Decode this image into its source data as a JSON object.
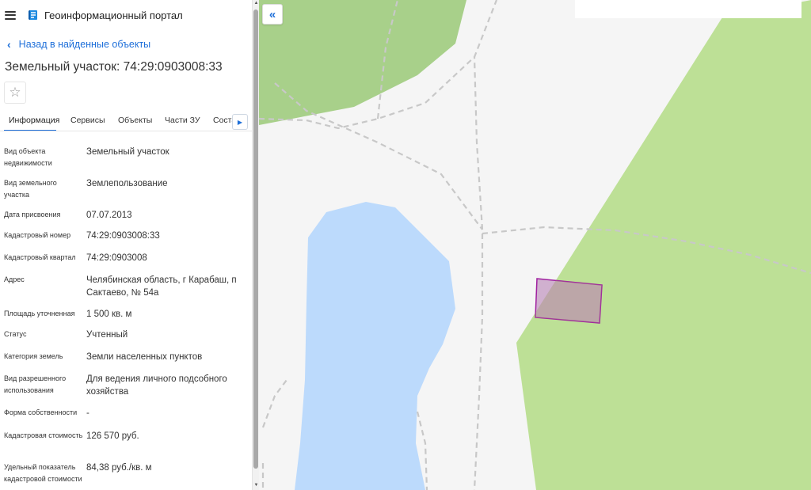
{
  "header": {
    "menu_icon": "hamburger-icon",
    "logo_icon": "portal-logo-icon",
    "title": "Геоинформационный портал"
  },
  "back_link": {
    "label": "Назад в найденные объекты",
    "icon": "chevron-left-icon"
  },
  "object_title": "Земельный участок: 74:29:0903008:33",
  "favorite_icon": "star-icon",
  "tabs": [
    {
      "label": "Информация",
      "active": true
    },
    {
      "label": "Сервисы"
    },
    {
      "label": "Объекты"
    },
    {
      "label": "Части ЗУ"
    },
    {
      "label": "Соста"
    }
  ],
  "tabs_next_icon": "arrow-right-icon",
  "properties": [
    {
      "label": "Вид объекта недвижимости",
      "value": "Земельный участок"
    },
    {
      "label": "Вид земельного участка",
      "value": "Землепользование"
    },
    {
      "label": "Дата присвоения",
      "value": "07.07.2013"
    },
    {
      "label": "Кадастровый номер",
      "value": "74:29:0903008:33"
    },
    {
      "label": "Кадастровый квартал",
      "value": "74:29:0903008"
    },
    {
      "label": "Адрес",
      "value": "Челябинская область, г Карабаш, п Сактаево, № 54а"
    },
    {
      "label": "Площадь уточненная",
      "value": "1 500 кв. м"
    },
    {
      "label": "Статус",
      "value": "Учтенный"
    },
    {
      "label": "Категория земель",
      "value": "Земли населенных пунктов"
    },
    {
      "label": "Вид разрешенного использования",
      "value": "Для ведения личного подсобного хозяйства"
    },
    {
      "label": "Форма собственности",
      "value": "-"
    },
    {
      "label": "Кадастровая стоимость",
      "value": "126 570 руб."
    },
    {
      "label": "Удельный показатель кадастровой стоимости",
      "value": "84,38 руб./кв. м"
    }
  ],
  "map": {
    "collapse_icon": "double-chevron-left-icon",
    "colors": {
      "background": "#f5f5f5",
      "forest": "#bde096",
      "forest_dark": "#a8d08a",
      "water": "#bcdafc",
      "parcel_fill": "#c9a3c8",
      "parcel_stroke": "#a020a0",
      "path": "#c8c8c8"
    }
  },
  "colors": {
    "accent": "#1e6fd9"
  }
}
